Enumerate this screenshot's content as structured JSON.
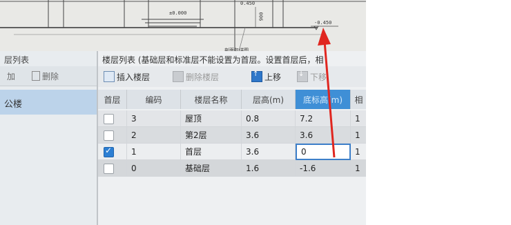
{
  "drawing": {
    "elevations": [
      "±0.000",
      "0.450",
      "-0.450",
      "900"
    ],
    "caption_fragment": "剖面包详图"
  },
  "left_panel": {
    "title_fragment": "层列表",
    "toolbar": [
      {
        "label": "加",
        "icon": "add-icon"
      },
      {
        "label": "删除",
        "icon": "delete-icon"
      }
    ],
    "tree_item": "公楼"
  },
  "main_panel": {
    "title": "楼层列表 (基础层和标准层不能设置为首层。设置首层后，相",
    "toolbar": [
      {
        "label": "插入楼层",
        "icon": "insert-floor-icon",
        "enabled": true
      },
      {
        "label": "删除楼层",
        "icon": "delete-floor-icon",
        "enabled": false
      },
      {
        "label": "上移",
        "icon": "move-up-icon",
        "enabled": true
      },
      {
        "label": "下移",
        "icon": "move-down-icon",
        "enabled": false
      }
    ],
    "columns": [
      "首层",
      "编码",
      "楼层名称",
      "层高(m)",
      "底标高(m)",
      "相"
    ],
    "rows": [
      {
        "first": false,
        "code": "3",
        "name": "屋顶",
        "height": "0.8",
        "base": "7.2",
        "same": "1"
      },
      {
        "first": false,
        "code": "2",
        "name": "第2层",
        "height": "3.6",
        "base": "3.6",
        "same": "1"
      },
      {
        "first": true,
        "code": "1",
        "name": "首层",
        "height": "3.6",
        "base": "0",
        "same": "1"
      },
      {
        "first": false,
        "code": "0",
        "name": "基础层",
        "height": "1.6",
        "base": "-1.6",
        "same": "1"
      }
    ],
    "selected_column": "底标高(m)",
    "editing_row": 2
  },
  "colors": {
    "accent": "#3f8fd6",
    "annotation_arrow": "#e0261f",
    "selected_row": "#bcd3ea"
  }
}
